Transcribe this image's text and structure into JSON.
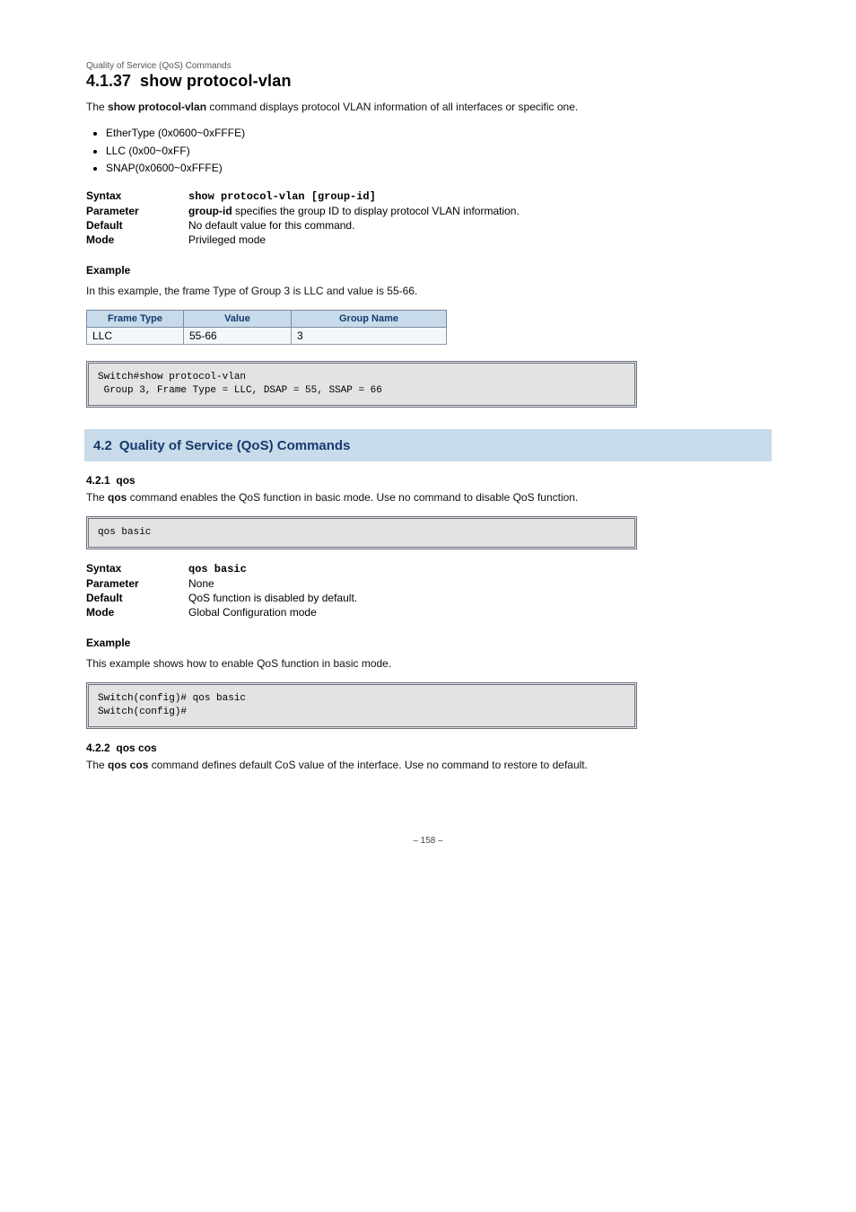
{
  "breadcrumb": "Quality of Service (QoS) Commands",
  "heading": {
    "num": "4.1.37",
    "title": "show protocol-vlan"
  },
  "intro": {
    "lead": "The ",
    "cmd": "show protocol-vlan ",
    "rest": "command displays protocol VLAN information of all interfaces or specific one."
  },
  "bullets": [
    "EtherType (0x0600~0xFFFE)",
    "LLC (0x00~0xFF)",
    "SNAP(0x0600~0xFFFE)"
  ],
  "fields": {
    "syntax_label": "Syntax",
    "syntax_value": "show protocol-vlan [group-id]",
    "param_label": "Parameter",
    "param_value": "group-id ",
    "param_value_rest": "specifies the group ID to display protocol VLAN information.",
    "default_label": "Default",
    "default_value": "No default value for this command.",
    "mode_label": "Mode",
    "mode_value": "Privileged mode"
  },
  "example_label": "Example",
  "example_intro": "In this example, the frame Type of Group 3 is LLC and value is 55-66.",
  "table": {
    "headers": [
      "Frame Type",
      "Value",
      "Group Name"
    ],
    "row": [
      "LLC",
      "55-66",
      "3"
    ]
  },
  "codebox1": "Switch#show protocol-vlan\n Group 3, Frame Type = LLC, DSAP = 55, SSAP = 66",
  "section": {
    "num": "4.2",
    "title": "Quality of Service (QoS) Commands"
  },
  "sub": {
    "num": "4.2.1",
    "title": "qos",
    "lead": "The ",
    "cmd": "qos ",
    "rest": "command enables the QoS function in basic mode. Use no command to disable QoS function.",
    "syntax_label": "Syntax",
    "syntax_value": "qos basic",
    "param_label": "Parameter",
    "param_value": "None",
    "default_label": "Default",
    "default_value": "QoS function is disabled by default.",
    "mode_label": "Mode",
    "mode_value": "Global Configuration mode",
    "example_label": "Example",
    "example_line": "This example shows how to enable QoS function in basic mode."
  },
  "codebox2": "Switch(config)# qos basic\nSwitch(config)#",
  "sub2": {
    "num": "4.2.2",
    "title": "qos cos",
    "lead": "The ",
    "cmd": "qos cos ",
    "rest": "command defines default CoS value of the interface. Use no command to restore to default."
  },
  "footer": "– 158 –"
}
